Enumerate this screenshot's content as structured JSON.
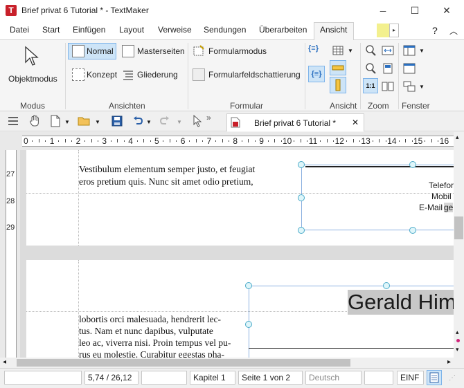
{
  "window": {
    "app_letter": "T",
    "title": "Brief privat 6 Tutorial * - TextMaker",
    "minimize_glyph": "─",
    "maximize_glyph": "☐",
    "close_glyph": "✕"
  },
  "menu": {
    "tabs": [
      "Datei",
      "Start",
      "Einfügen",
      "Layout",
      "Verweise",
      "Sendungen",
      "Überarbeiten",
      "Ansicht"
    ],
    "scroll_glyph": "▸",
    "help": "?",
    "collapse": "︿"
  },
  "ribbon": {
    "objektmodus": "Objektmodus",
    "normal": "Normal",
    "masterseiten": "Masterseiten",
    "konzept": "Konzept",
    "gliederung": "Gliederung",
    "formularmodus": "Formularmodus",
    "formularfeldschattierung": "Formularfeldschattierung",
    "zoom_11": "1:1",
    "field_brace": "{≡}",
    "groups": {
      "modus": "Modus",
      "ansichten": "Ansichten",
      "formular": "Formular",
      "ansicht": "Ansicht",
      "zoom": "Zoom",
      "fenster": "Fenster"
    }
  },
  "toolbar": {
    "doc_tab_label": "Brief privat 6 Tutorial *",
    "doc_tab_close": "✕",
    "more": "»"
  },
  "ruler": {
    "h_labels": [
      "0",
      "1",
      "2",
      "3",
      "4",
      "5",
      "6",
      "7",
      "8",
      "9",
      "10",
      "11",
      "12",
      "13",
      "14",
      "15",
      "16"
    ],
    "v_labels": [
      "27",
      "28",
      "29"
    ]
  },
  "document": {
    "page1_text": [
      "Vestibulum elementum semper justo, et feugiat",
      "eros pretium quis. Nunc sit amet odio pretium,"
    ],
    "page1_frame_lines": [
      "Telefor",
      "Mobil",
      "E-Mail"
    ],
    "page1_frame_highlight": "ge",
    "page2_heading": "Gerald Him",
    "page2_text": [
      "lobortis orci malesuada, hendrerit lec-",
      "tus. Nam et nunc dapibus, vulputate",
      "leo ac, viverra nisi. Proin tempus vel pu-",
      "rus eu molestie. Curabitur egestas pha-"
    ]
  },
  "statusbar": {
    "field1": "",
    "position": "5,74 / 26,12",
    "field3": "",
    "chapter": "Kapitel 1",
    "page": "Seite 1 von 2",
    "language": "Deutsch",
    "field7": "",
    "mode": "EINF"
  },
  "scrollbars": {
    "up": "▴",
    "down": "▾",
    "left": "◂",
    "right": "▸"
  },
  "colors": {
    "accent_active": "#cde4f7",
    "app_icon": "#c8202a",
    "frame_handle": "#4aaac9",
    "highlight": "#d6d6d6"
  }
}
